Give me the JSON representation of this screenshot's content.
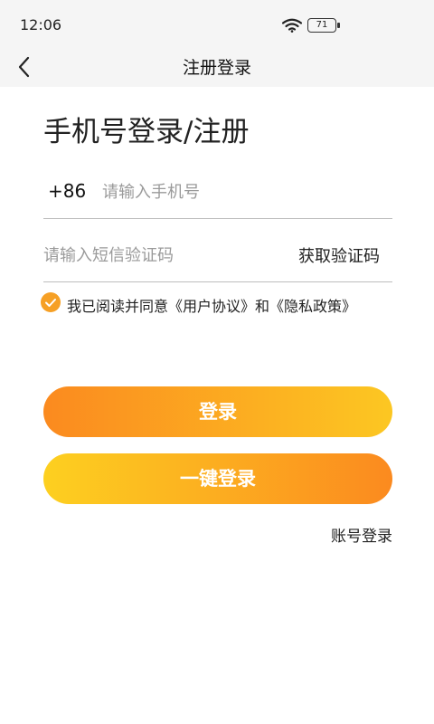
{
  "status_bar": {
    "time": "12:06",
    "battery": "71",
    "wifi_icon": "wifi-icon"
  },
  "nav": {
    "back_icon": "chevron-left-icon",
    "title": "注册登录"
  },
  "heading": "手机号登录/注册",
  "phone": {
    "country_code": "+86",
    "value": "",
    "placeholder": "请输入手机号"
  },
  "code": {
    "value": "",
    "placeholder": "请输入短信验证码",
    "get_code_label": "获取验证码"
  },
  "agreement": {
    "checked": true,
    "check_icon": "checkmark-icon",
    "text": "我已阅读并同意《用户协议》和《隐私政策》"
  },
  "buttons": {
    "login": "登录",
    "one_click_login": "一键登录"
  },
  "account_login": "账号登录",
  "colors": {
    "accent": "#f6a025",
    "gradient_orange": "#fb8a1f",
    "gradient_yellow": "#fcc722"
  }
}
